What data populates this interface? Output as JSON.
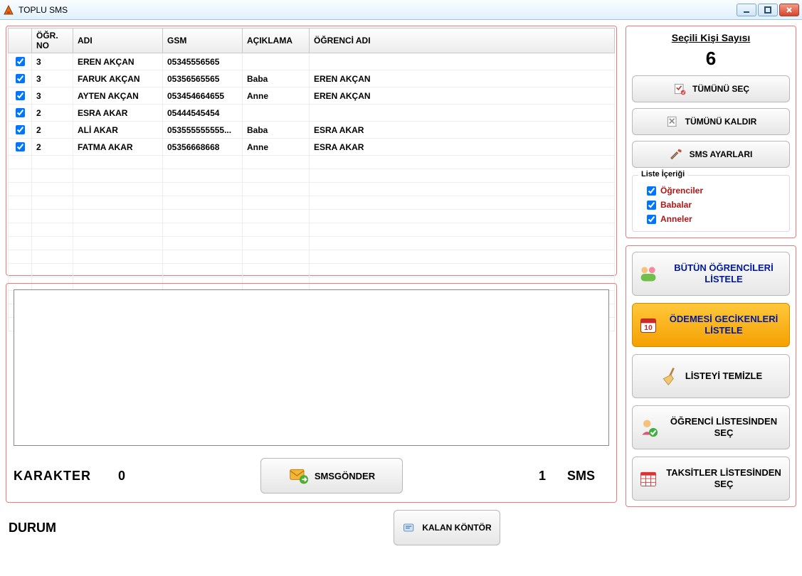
{
  "window": {
    "title": "TOPLU SMS"
  },
  "grid": {
    "headers": [
      "ÖĞR. NO",
      "ADI",
      "GSM",
      "AÇIKLAMA",
      "ÖĞRENCİ ADI"
    ],
    "rows": [
      {
        "chk": true,
        "no": "3",
        "adi": "EREN  AKÇAN",
        "gsm": "05345556565",
        "aciklama": "",
        "ogrenci": ""
      },
      {
        "chk": true,
        "no": "3",
        "adi": "FARUK AKÇAN",
        "gsm": "05356565565",
        "aciklama": "Baba",
        "ogrenci": "EREN  AKÇAN"
      },
      {
        "chk": true,
        "no": "3",
        "adi": "AYTEN AKÇAN",
        "gsm": "053454664655",
        "aciklama": "Anne",
        "ogrenci": "EREN  AKÇAN"
      },
      {
        "chk": true,
        "no": "2",
        "adi": "ESRA AKAR",
        "gsm": "05444545454",
        "aciklama": "",
        "ogrenci": ""
      },
      {
        "chk": true,
        "no": "2",
        "adi": "ALİ AKAR",
        "gsm": "053555555555...",
        "aciklama": "Baba",
        "ogrenci": "ESRA AKAR"
      },
      {
        "chk": true,
        "no": "2",
        "adi": "FATMA AKAR",
        "gsm": "05356668668",
        "aciklama": "Anne",
        "ogrenci": "ESRA AKAR"
      }
    ]
  },
  "msg": {
    "karakter_label": "KARAKTER",
    "karakter_value": "0",
    "send_label": "SMSGÖNDER",
    "sms_count": "1",
    "sms_label": "SMS"
  },
  "durum": {
    "label": "DURUM",
    "kontor_label": "KALAN KÖNTÖR"
  },
  "right": {
    "selcount_title": "Seçili Kişi Sayısı",
    "selcount_value": "6",
    "select_all": "TÜMÜNÜ SEÇ",
    "deselect_all": "TÜMÜNÜ KALDIR",
    "sms_settings": "SMS AYARLARI",
    "group_legend": "Liste İçeriği",
    "opt_students": "Öğrenciler",
    "opt_fathers": "Babalar",
    "opt_mothers": "Anneler",
    "list_all": "BÜTÜN ÖĞRENCİLERİ LİSTELE",
    "list_late": "ÖDEMESİ GECİKENLERİ LİSTELE",
    "clear_list": "LİSTEYİ TEMİZLE",
    "from_students": "ÖĞRENCİ LİSTESİNDEN SEÇ",
    "from_installments": "TAKSİTLER LİSTESİNDEN SEÇ"
  }
}
